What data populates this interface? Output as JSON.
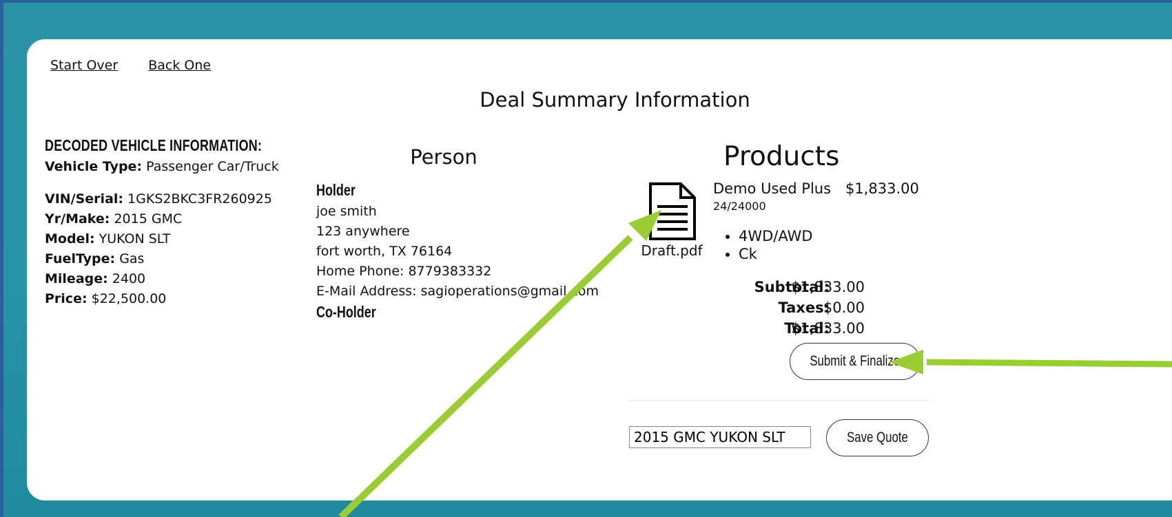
{
  "nav": {
    "start_over": "Start Over",
    "back_one": "Back One"
  },
  "page_title": "Deal Summary Information",
  "vehicle": {
    "heading": "DECODED VEHICLE INFORMATION:",
    "type_label": "Vehicle Type:",
    "type_value": "Passenger Car/Truck",
    "vin_label": "VIN/Serial:",
    "vin_value": "1GKS2BKC3FR260925",
    "yrmake_label": "Yr/Make:",
    "yrmake_value": "2015 GMC",
    "model_label": "Model:",
    "model_value": "YUKON SLT",
    "fuel_label": "FuelType:",
    "fuel_value": "Gas",
    "mileage_label": "Mileage:",
    "mileage_value": "2400",
    "price_label": "Price:",
    "price_value": "$22,500.00"
  },
  "person": {
    "title": "Person",
    "holder_heading": "Holder",
    "name": "joe smith",
    "address1": "123 anywhere",
    "address2": "fort worth, TX 76164",
    "phone": "Home Phone: 8779383332",
    "email": "E-Mail Address: sagioperations@gmail.com",
    "coholder_heading": "Co-Holder"
  },
  "products": {
    "title": "Products",
    "doc_filename": "Draft.pdf",
    "doc_icon": "document-icon",
    "product_name": "Demo Used Plus",
    "product_price": "$1,833.00",
    "product_term": "24/24000",
    "features": [
      "4WD/AWD",
      "Ck"
    ],
    "subtotal_label": "Subtotal:",
    "subtotal_value": "$1,833.00",
    "taxes_label": "Taxes:",
    "taxes_value": "$0.00",
    "total_label": "Total:",
    "total_value": "$1,833.00",
    "submit_label": "Submit & Finalize"
  },
  "quote": {
    "input_value": "2015 GMC YUKON SLT",
    "save_label": "Save Quote"
  },
  "colors": {
    "background": "#2793a7",
    "annotation_arrow": "#9acd32"
  }
}
